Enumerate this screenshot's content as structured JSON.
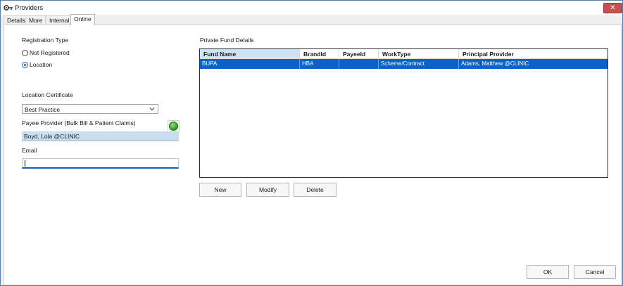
{
  "window": {
    "title": "Providers",
    "close_glyph": "✕"
  },
  "tabs": [
    {
      "label": "Details"
    },
    {
      "label": "More"
    },
    {
      "label": "Internal"
    },
    {
      "label": "Online"
    }
  ],
  "registration": {
    "heading": "Registration Type",
    "options": [
      {
        "label": "Not Registered",
        "checked": false
      },
      {
        "label": "Location",
        "checked": true
      }
    ]
  },
  "location_certificate": {
    "label": "Location Certificate",
    "value": "Best Practice"
  },
  "payee": {
    "label": "Payee Provider (Bulk Bill & Patient Claims)",
    "value": "Boyd, Lola @CLINIC"
  },
  "email": {
    "label": "Email",
    "value": ""
  },
  "private_fund": {
    "heading": "Private Fund Details",
    "columns": [
      "Fund Name",
      "BrandId",
      "PayeeId",
      "WorkType",
      "Principal Provider"
    ],
    "rows": [
      [
        "BUPA",
        "HBA",
        "",
        "Scheme/Contract",
        "Adams, Matthew @CLINIC"
      ]
    ]
  },
  "buttons": {
    "new": "New",
    "modify": "Modify",
    "delete": "Delete",
    "ok": "OK",
    "cancel": "Cancel"
  },
  "colors": {
    "selection": "#0a62c8",
    "accent": "#1e5ba8",
    "close": "#c75050"
  }
}
